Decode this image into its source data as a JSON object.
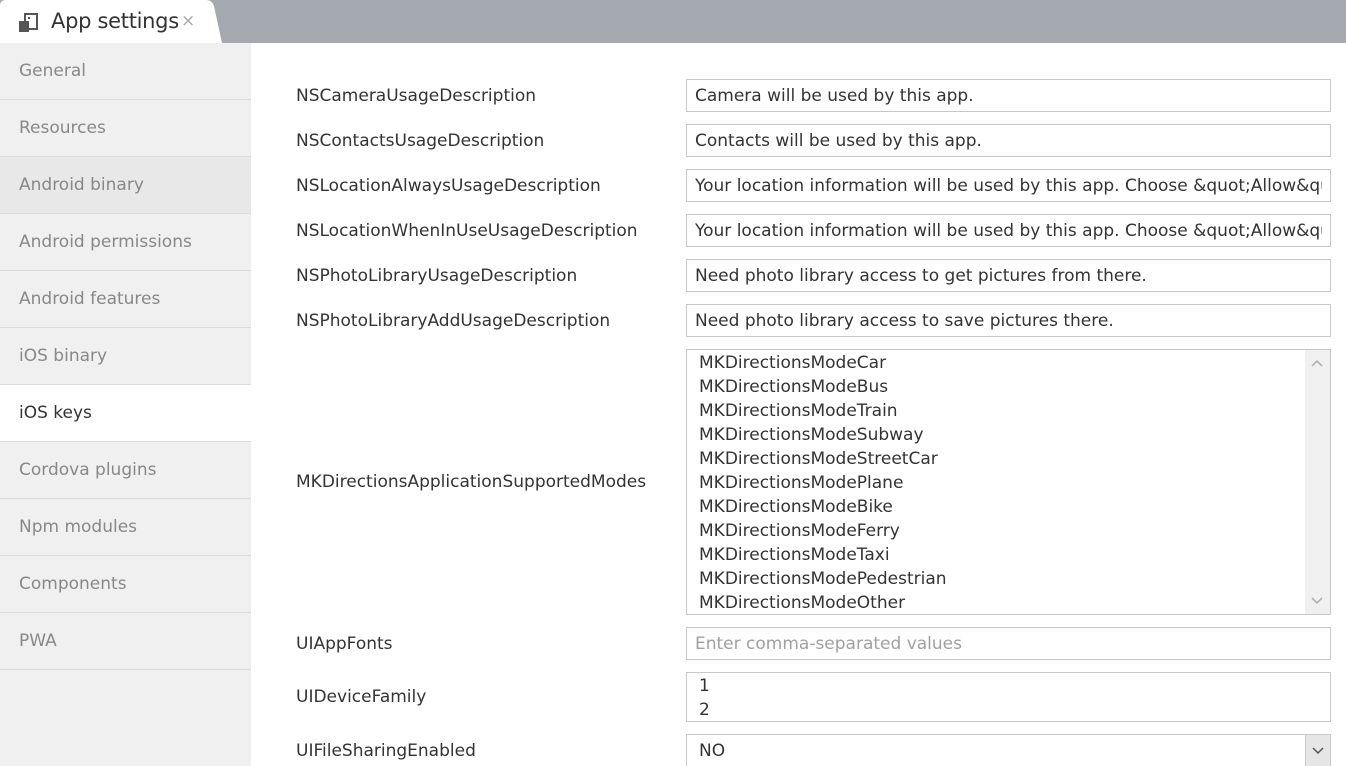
{
  "tab": {
    "title": "App settings",
    "close_glyph": "×",
    "icon": "app-settings-icon"
  },
  "sidebar": {
    "items": [
      {
        "label": "General"
      },
      {
        "label": "Resources"
      },
      {
        "label": "Android binary"
      },
      {
        "label": "Android permissions"
      },
      {
        "label": "Android features"
      },
      {
        "label": "iOS binary"
      },
      {
        "label": "iOS keys",
        "active": true
      },
      {
        "label": "Cordova plugins"
      },
      {
        "label": "Npm modules"
      },
      {
        "label": "Components"
      },
      {
        "label": "PWA"
      }
    ]
  },
  "fields": [
    {
      "label": "NSCameraUsageDescription",
      "value": "Camera will be used by this app."
    },
    {
      "label": "NSContactsUsageDescription",
      "value": "Contacts will be used by this app."
    },
    {
      "label": "NSLocationAlwaysUsageDescription",
      "value": "Your location information will be used by this app. Choose &quot;Allow&quot; to proceed."
    },
    {
      "label": "NSLocationWhenInUseUsageDescription",
      "value": "Your location information will be used by this app. Choose &quot;Allow&quot; to proceed."
    },
    {
      "label": "NSPhotoLibraryUsageDescription",
      "value": "Need photo library access to get pictures from there."
    },
    {
      "label": "NSPhotoLibraryAddUsageDescription",
      "value": "Need photo library access to save pictures there."
    }
  ],
  "directions": {
    "label": "MKDirectionsApplicationSupportedModes",
    "options": [
      "MKDirectionsModeCar",
      "MKDirectionsModeBus",
      "MKDirectionsModeTrain",
      "MKDirectionsModeSubway",
      "MKDirectionsModeStreetCar",
      "MKDirectionsModePlane",
      "MKDirectionsModeBike",
      "MKDirectionsModeFerry",
      "MKDirectionsModeTaxi",
      "MKDirectionsModePedestrian",
      "MKDirectionsModeOther"
    ]
  },
  "fonts": {
    "label": "UIAppFonts",
    "value": "",
    "placeholder": "Enter comma-separated values"
  },
  "device_family": {
    "label": "UIDeviceFamily",
    "options": [
      "1",
      "2"
    ]
  },
  "file_sharing": {
    "label": "UIFileSharingEnabled",
    "value": "NO"
  },
  "colors": {
    "tabbar": "#a4a9b0",
    "sidebar": "#f0f0f0",
    "active": "#ffffff"
  }
}
